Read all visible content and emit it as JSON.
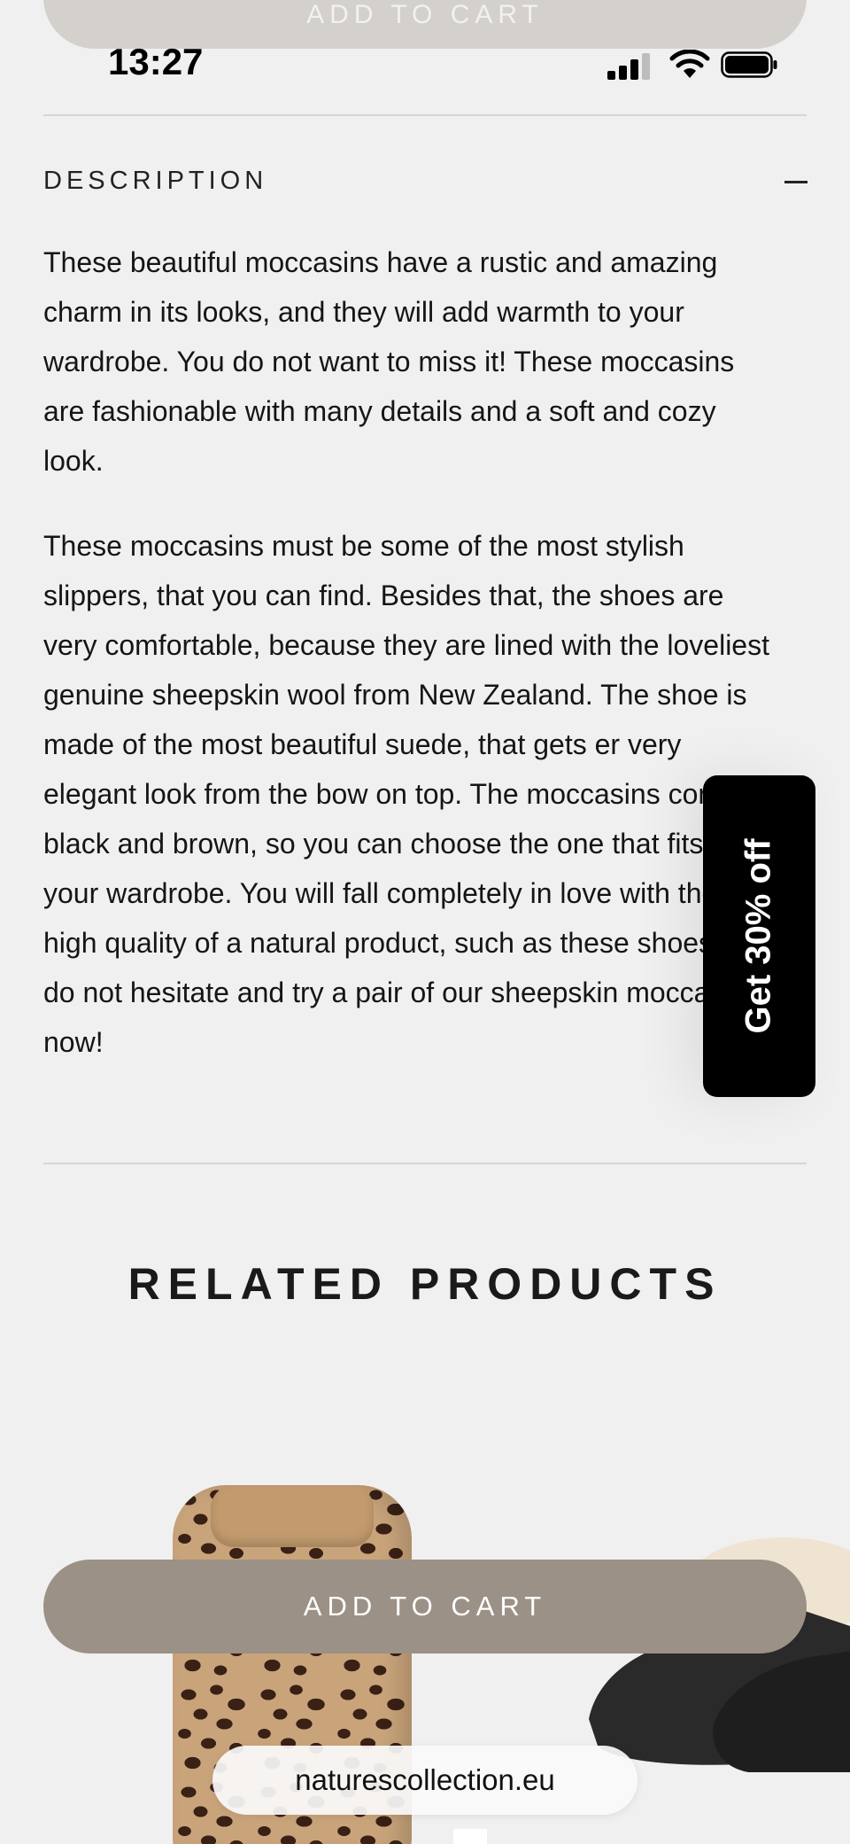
{
  "sticky_top": {
    "add_to_cart_label": "ADD TO CART"
  },
  "status_bar": {
    "time": "13:27"
  },
  "description": {
    "heading": "DESCRIPTION",
    "paragraphs": [
      "These beautiful moccasins have a rustic and amazing charm in its looks, and they will add warmth to your wardrobe. You do not want to miss it! These moccasins are fashionable with many details and a soft and cozy look.",
      "These moccasins must be some of the most stylish slippers, that you can find. Besides that, the shoes are very comfortable, because they are lined with the loveliest genuine sheepskin wool from New Zealand. The shoe is made of the most beautiful suede, that gets er very elegant look from the bow on top. The moccasins come in black and brown, so you can choose the one that fits into your wardrobe. You will fall completely in love with the high quality of a natural product, such as these shoes. So do not hesitate and try a pair of our sheepskin moccasins now!"
    ]
  },
  "promo": {
    "label": "Get 30% off"
  },
  "related": {
    "title": "RELATED PRODUCTS"
  },
  "cart": {
    "add_to_cart_label": "ADD TO CART"
  },
  "browser": {
    "url": "naturescollection.eu"
  },
  "colors": {
    "cart_button": "#9b9186",
    "background": "#f0f0f0",
    "promo_bg": "#000000"
  }
}
